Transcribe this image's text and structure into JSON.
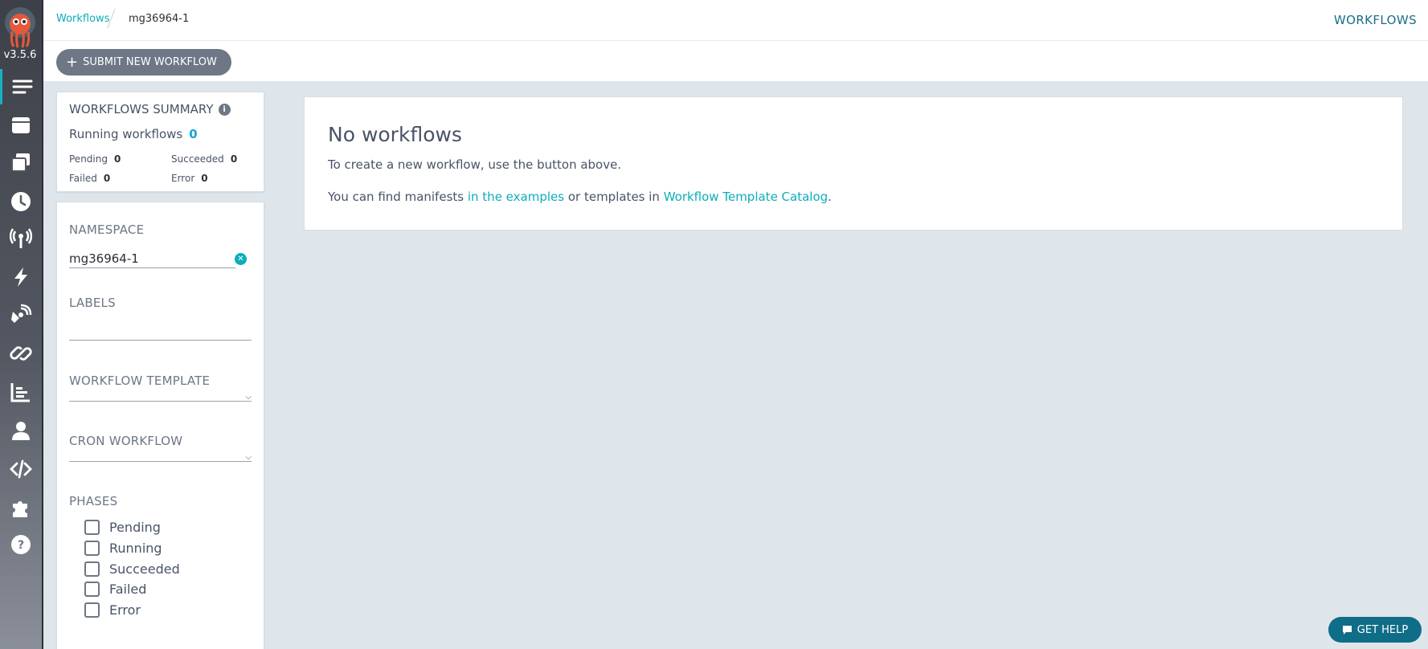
{
  "app": {
    "version": "v3.5.6"
  },
  "nav": {
    "items": [
      {
        "icon": "menu-icon",
        "active": true
      },
      {
        "icon": "window-icon"
      },
      {
        "icon": "archive-stack-icon"
      },
      {
        "icon": "clock-icon"
      },
      {
        "icon": "broadcast-icon"
      },
      {
        "icon": "bolt-icon"
      },
      {
        "icon": "satellite-icon"
      },
      {
        "icon": "link-icon"
      },
      {
        "icon": "chart-icon"
      },
      {
        "icon": "user-icon"
      },
      {
        "icon": "code-icon"
      },
      {
        "icon": "puzzle-icon"
      },
      {
        "icon": "help-circle-icon"
      }
    ]
  },
  "topbar": {
    "breadcrumb_link": "Workflows",
    "breadcrumb_current": "mg36964-1",
    "title": "WORKFLOWS"
  },
  "toolbar": {
    "submit_label": "SUBMIT NEW WORKFLOW"
  },
  "summary": {
    "title": "WORKFLOWS SUMMARY",
    "running_label": "Running workflows",
    "running_count": "0",
    "pending_label": "Pending",
    "pending_count": "0",
    "succeeded_label": "Succeeded",
    "succeeded_count": "0",
    "failed_label": "Failed",
    "failed_count": "0",
    "error_label": "Error",
    "error_count": "0"
  },
  "filters": {
    "namespace_label": "NAMESPACE",
    "namespace_value": "mg36964-1",
    "labels_label": "LABELS",
    "template_label": "WORKFLOW TEMPLATE",
    "cron_label": "CRON WORKFLOW",
    "phases_label": "PHASES",
    "phases": [
      "Pending",
      "Running",
      "Succeeded",
      "Failed",
      "Error"
    ]
  },
  "main": {
    "heading": "No workflows",
    "line1": "To create a new workflow, use the button above.",
    "line2_prefix": "You can find manifests ",
    "examples_link": "in the examples",
    "line2_middle": " or templates in ",
    "catalog_link": "Workflow Template Catalog",
    "line2_suffix": "."
  },
  "help": {
    "label": "GET HELP"
  },
  "colors": {
    "accent": "#0dadbb",
    "help": "#0f6d87",
    "nav_bg": "#3d4048"
  }
}
